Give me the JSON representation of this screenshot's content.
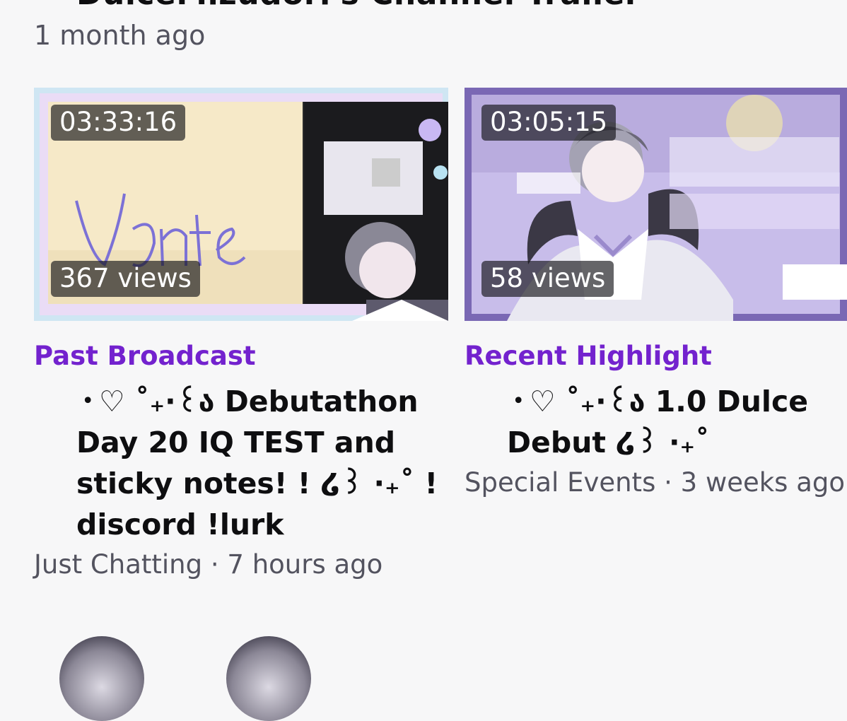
{
  "previous_video": {
    "title": "DulceMizudori's Channel Trailer",
    "age": "1 month ago"
  },
  "videos": [
    {
      "duration": "03:33:16",
      "views": "367 views",
      "type": "Past Broadcast",
      "title": "・♡ ˚₊·꒰ა Debutathon Day 20 IQ TEST and sticky notes! ! ໒꒱ ·₊˚ ! discord !lurk",
      "category": "Just Chatting",
      "separator": "·",
      "age": "7 hours ago"
    },
    {
      "duration": "03:05:15",
      "views": "58 views",
      "type": "Recent Highlight",
      "title": "・♡ ˚₊·꒰ა 1.0 Dulce Debut ໒꒱ ·₊˚",
      "category": "Special Events",
      "separator": "·",
      "age": "3 weeks ago"
    }
  ],
  "colors": {
    "accent": "#7322ce",
    "background": "#f7f7f8",
    "text_primary": "#0e0e10",
    "text_secondary": "#53535f"
  }
}
